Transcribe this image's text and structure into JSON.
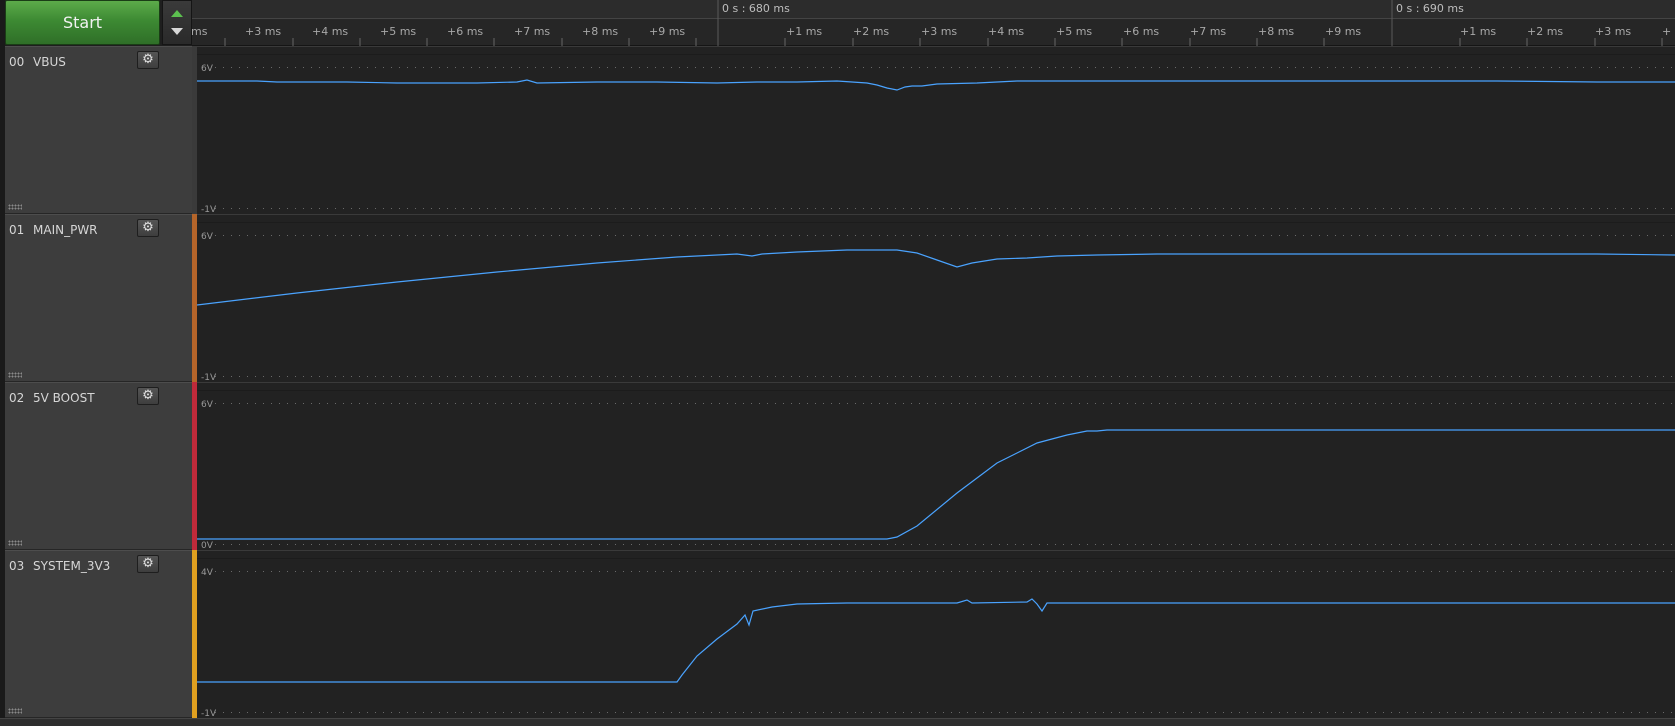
{
  "controls": {
    "start_label": "Start"
  },
  "ruler": {
    "major_labels": [
      "0 s : 680 ms",
      "0 s : 690 ms"
    ],
    "tick_labels_row1": [
      "ms",
      "+3 ms",
      "+4 ms",
      "+5 ms",
      "+6 ms",
      "+7 ms",
      "+8 ms",
      "+9 ms"
    ],
    "tick_labels_row2": [
      "+1 ms",
      "+2 ms",
      "+3 ms",
      "+4 ms",
      "+5 ms",
      "+6 ms",
      "+7 ms",
      "+8 ms",
      "+9 ms"
    ],
    "tick_labels_row3": [
      "+1 ms",
      "+2 ms",
      "+3 ms",
      "+"
    ]
  },
  "channels": [
    {
      "index": "00",
      "name": "VBUS",
      "y_max": "6V",
      "y_min": "-1V",
      "color": "#3a3a3a"
    },
    {
      "index": "01",
      "name": "MAIN_PWR",
      "y_max": "6V",
      "y_min": "-1V",
      "color": "#b5652a"
    },
    {
      "index": "02",
      "name": "5V BOOST",
      "y_max": "6V",
      "y_min": "0V",
      "color": "#c02a3a"
    },
    {
      "index": "03",
      "name": "SYSTEM_3V3",
      "y_max": "4V",
      "y_min": "-1V",
      "color": "#e0a020"
    }
  ],
  "colors": {
    "trace": "#4aa3ff",
    "plot_bg": "#222222",
    "panel_bg": "#3d3d3d"
  },
  "icons": {
    "settings": "gear-icon",
    "grip": "grip-icon",
    "spinner_up": "arrow-up-icon",
    "spinner_down": "arrow-down-icon"
  }
}
